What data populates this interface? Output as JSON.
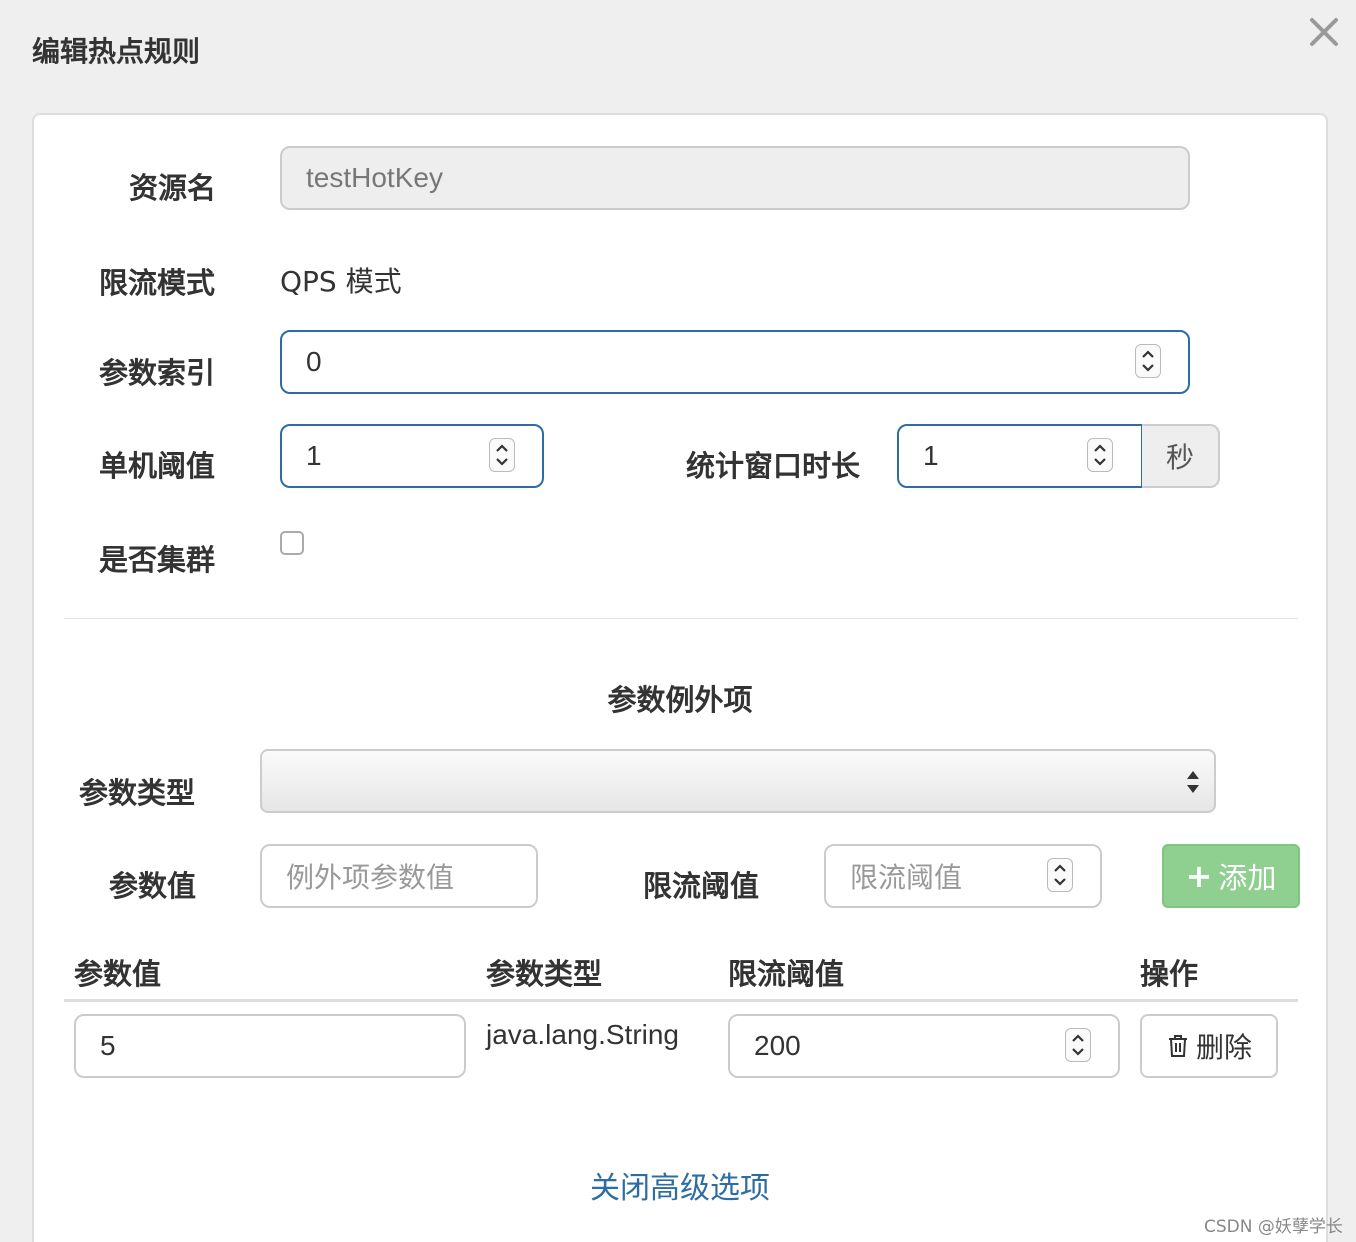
{
  "dialog": {
    "title": "编辑热点规则"
  },
  "form": {
    "resource_label": "资源名",
    "resource_value": "testHotKey",
    "mode_label": "限流模式",
    "mode_value": "QPS 模式",
    "param_index_label": "参数索引",
    "param_index_value": "0",
    "threshold_label": "单机阈值",
    "threshold_value": "1",
    "window_label": "统计窗口时长",
    "window_value": "1",
    "window_unit": "秒",
    "cluster_label": "是否集群",
    "cluster_checked": false
  },
  "exceptions": {
    "section_title": "参数例外项",
    "param_type_label": "参数类型",
    "param_type_value": "",
    "param_value_label": "参数值",
    "param_value_placeholder": "例外项参数值",
    "limit_label": "限流阈值",
    "limit_placeholder": "限流阈值",
    "add_button": "添加",
    "add_icon": "plus-icon",
    "columns": [
      "参数值",
      "参数类型",
      "限流阈值",
      "操作"
    ],
    "rows": [
      {
        "param_value": "5",
        "param_type": "java.lang.String",
        "limit": "200",
        "delete_label": "删除",
        "delete_icon": "trash-icon"
      }
    ]
  },
  "advanced_toggle": "关闭高级选项",
  "watermark": "CSDN @妖孽学长",
  "colors": {
    "primary": "#2d6da3",
    "success": "#8fcf8f",
    "background": "#efefef"
  }
}
